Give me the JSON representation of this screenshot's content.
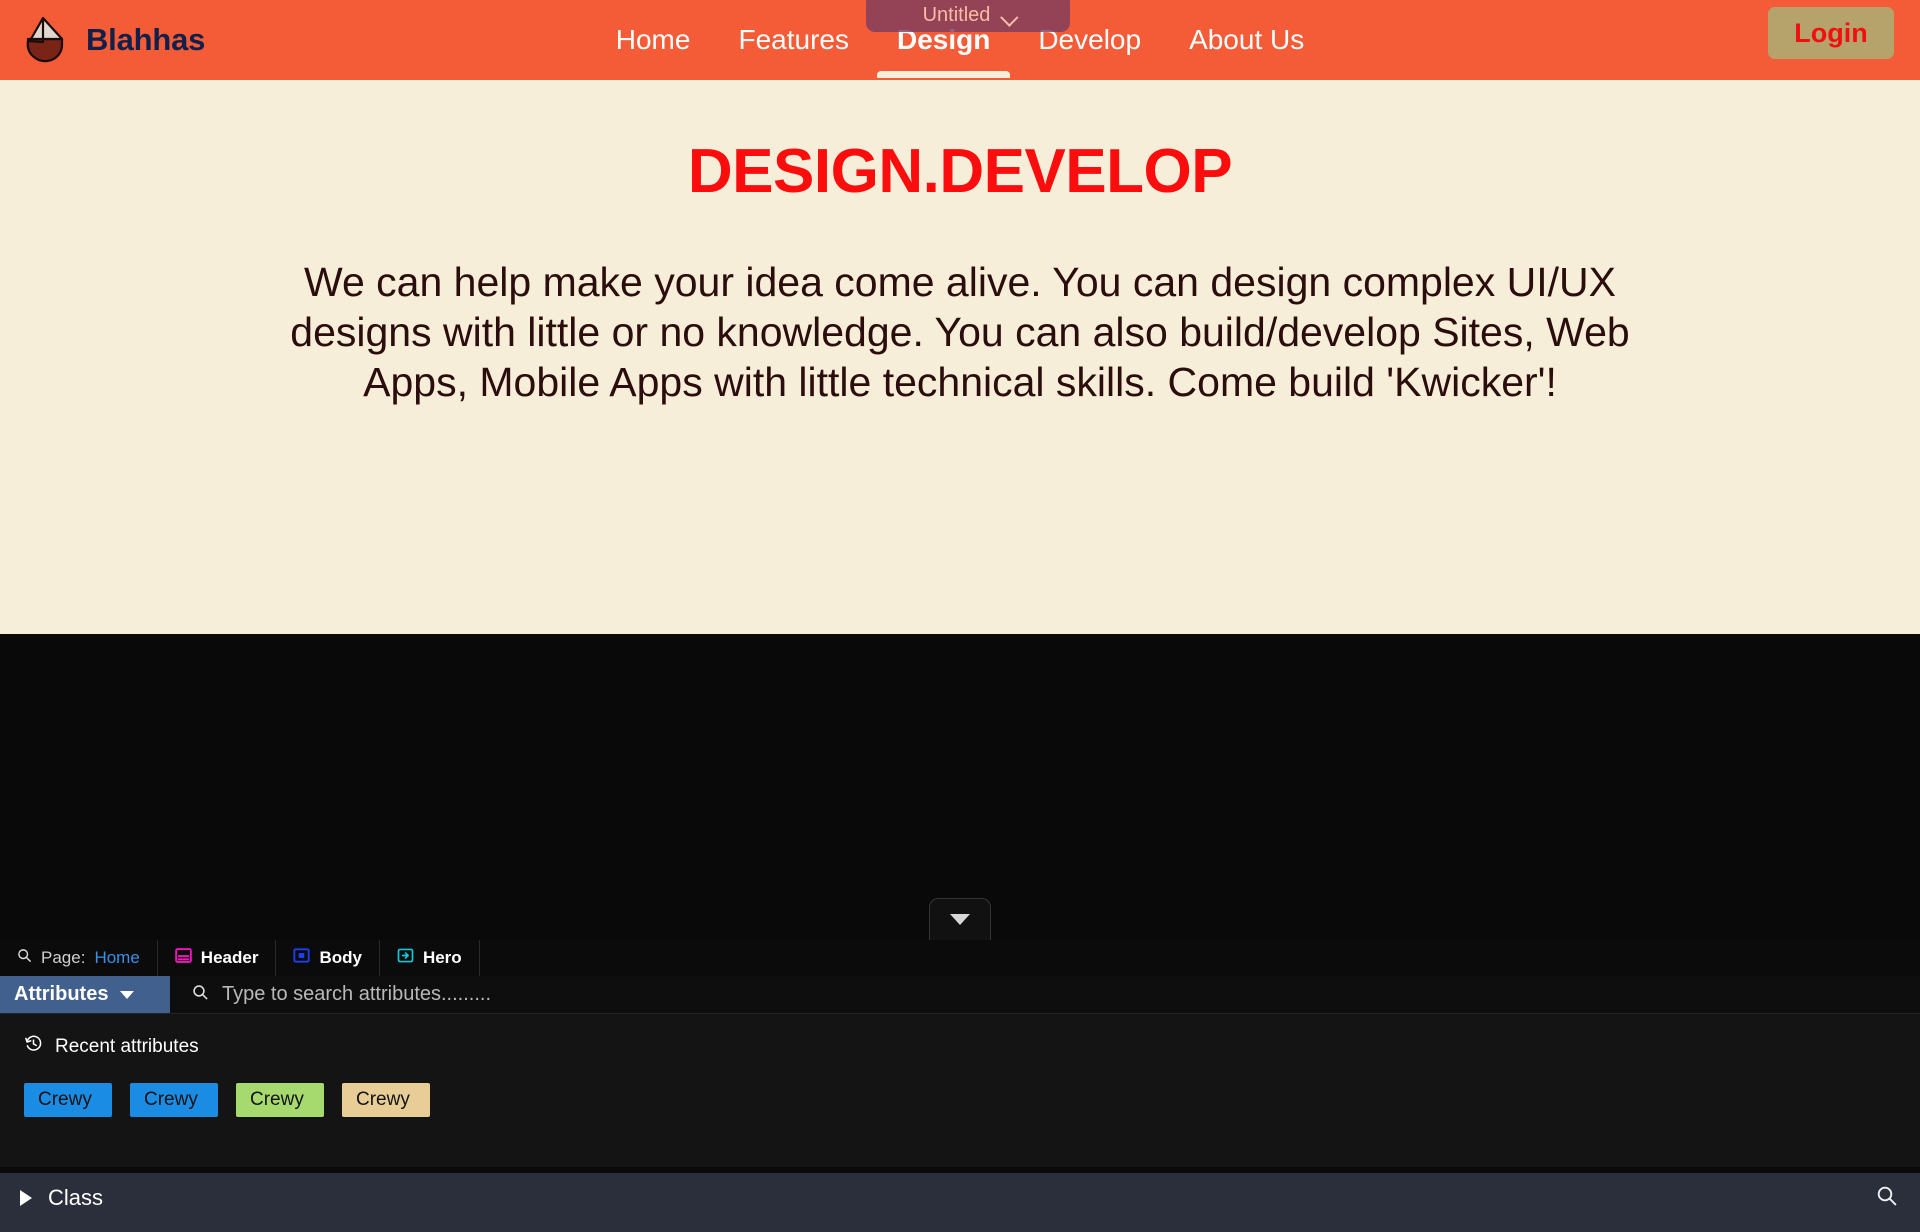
{
  "preview": {
    "brand": {
      "name": "Blahhas",
      "logo_icon": "sail-boat-logo-icon"
    },
    "nav": [
      {
        "label": "Home",
        "active": false
      },
      {
        "label": "Features",
        "active": false
      },
      {
        "label": "Design",
        "active": true
      },
      {
        "label": "Develop",
        "active": false
      },
      {
        "label": "About Us",
        "active": false
      }
    ],
    "login_label": "Login",
    "untitled_chip": {
      "label": "Untitled",
      "icon": "chevron-down-icon"
    },
    "hero": {
      "title": "DESIGN.DEVELOP",
      "copy": "We can help make your idea come alive. You can design complex UI/UX designs with little or no knowledge. You can also build/develop Sites, Web Apps, Mobile Apps with little technical skills. Come build 'Kwicker'!"
    },
    "collapse_tab_icon": "triangle-down-icon",
    "colors": {
      "header_orange": "#f45c38",
      "hero_cream": "#f6eed8",
      "hero_title_red": "#fb0d0d",
      "brand_navy": "#11204a",
      "login_tan": "#b6a36b",
      "login_text_red": "#f20f0f",
      "untitled_purple": "#7c3d5f"
    }
  },
  "editor": {
    "breadcrumb": [
      {
        "icon": "search-icon",
        "prefix": "Page:",
        "label": "Home",
        "style": "link"
      },
      {
        "icon": "header-block-icon",
        "prefix": "",
        "label": "Header",
        "style": "strong"
      },
      {
        "icon": "body-block-icon",
        "prefix": "",
        "label": "Body",
        "style": "strong"
      },
      {
        "icon": "hero-block-icon",
        "prefix": "",
        "label": "Hero",
        "style": "strong"
      }
    ],
    "attributes_tab": {
      "label": "Attributes",
      "icon": "caret-down-icon"
    },
    "search": {
      "placeholder": "Type to search attributes.........",
      "value": "",
      "icon": "search-icon"
    },
    "recent": {
      "icon": "history-clock-icon",
      "title": "Recent attributes",
      "chips": [
        {
          "label": "Crewy",
          "color": "#1b8ce3"
        },
        {
          "label": "Crewy",
          "color": "#1b8ce3"
        },
        {
          "label": "Crewy",
          "color": "#a7da6e"
        },
        {
          "label": "Crewy",
          "color": "#e8ce96"
        }
      ]
    },
    "class_section": {
      "label": "Class",
      "expand_icon": "triangle-right-icon",
      "search_icon": "search-icon"
    },
    "colors": {
      "tab_blue": "#41608d",
      "panel_dark": "#141414",
      "class_slate": "#2a2f3b"
    }
  }
}
